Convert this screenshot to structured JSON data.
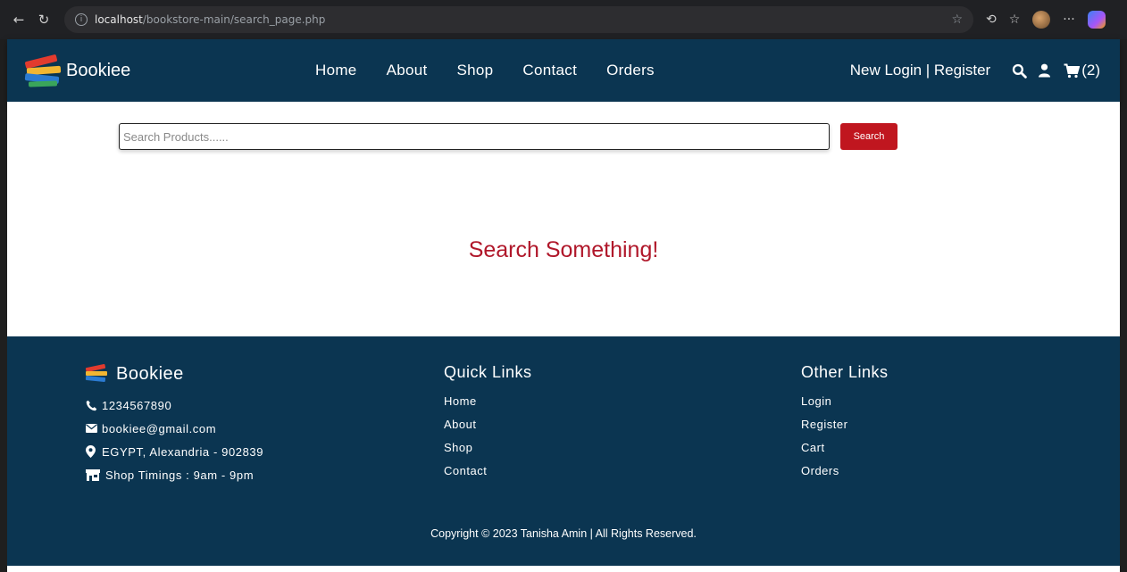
{
  "browser": {
    "url_host": "localhost",
    "url_path": "/bookstore-main/search_page.php"
  },
  "header": {
    "brand": "Bookiee",
    "nav": [
      "Home",
      "About",
      "Shop",
      "Contact",
      "Orders"
    ],
    "auth": "New Login | Register",
    "cart_count": "(2)"
  },
  "search": {
    "placeholder": "Search Products......",
    "button_label": "Search"
  },
  "empty_message": "Search Something!",
  "footer": {
    "brand": "Bookiee",
    "contact": {
      "phone": "1234567890",
      "email": "bookiee@gmail.com",
      "address": "EGYPT, Alexandria - 902839",
      "timings": "Shop Timings : 9am - 9pm"
    },
    "quick_links": {
      "title": "Quick Links",
      "items": [
        "Home",
        "About",
        "Shop",
        "Contact"
      ]
    },
    "other_links": {
      "title": "Other Links",
      "items": [
        "Login",
        "Register",
        "Cart",
        "Orders"
      ]
    },
    "copyright": "Copyright © 2023 Tanisha Amin | All Rights Reserved."
  },
  "colors": {
    "header_bg": "#0b3551",
    "accent_red": "#c0161f",
    "message_red": "#b0172a"
  }
}
